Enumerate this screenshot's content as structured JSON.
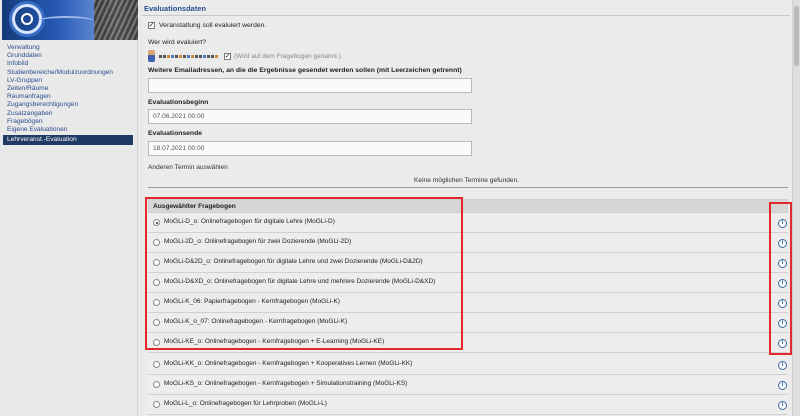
{
  "sidebar": {
    "items": [
      {
        "label": "Verwaltung"
      },
      {
        "label": "Grunddaten"
      },
      {
        "label": "Infobild"
      },
      {
        "label": "Studienbereiche/Modulzuordnungen"
      },
      {
        "label": "LV-Gruppen"
      },
      {
        "label": "Zeiten/Räume"
      },
      {
        "label": "Raumanfragen"
      },
      {
        "label": "Zugangsberechtigungen"
      },
      {
        "label": "Zusatzangaben"
      },
      {
        "label": "Fragebögen"
      },
      {
        "label": "Eigene Evaluationen"
      },
      {
        "label": "Lehrveranst.-Evaluation",
        "active": true
      }
    ]
  },
  "section": {
    "title": "Evaluationsdaten"
  },
  "evaluate_checkbox": {
    "checked": true,
    "label": "Veranstaltung soll evaluiert werden."
  },
  "evaluee": {
    "question": "Wer wird evaluiert?",
    "named_checkbox_checked": true,
    "named_hint": "(Wird auf dem Fragebogen genannt.)"
  },
  "emails": {
    "label": "Weitere Emailadressen, an die die Ergebnisse gesendet werden sollen (mit Leerzeichen getrennt)",
    "value": ""
  },
  "start": {
    "label": "Evaluationsbeginn",
    "value": "07.06.2021 00:00"
  },
  "end": {
    "label": "Evaluationsende",
    "value": "18.07.2021 00:00"
  },
  "other_term": {
    "label": "Anderen Termin auswählen"
  },
  "no_terms": {
    "text": "Keine möglichen Termine gefunden."
  },
  "questionnaire": {
    "header": "Ausgewählter Fragebogen",
    "options": [
      {
        "label": "MoGLi-D_o: Onlinefragebogen für digitale Lehre (MoGLi-D)",
        "selected": true
      },
      {
        "label": "MoGLi-2D_o: Onlinefragebogen für zwei Dozierende (MoGLi-2D)",
        "selected": false
      },
      {
        "label": "MoGLi-D&2D_o: Onlinefragebogen für digitale Lehre und zwei Dozierende (MoGLi-D&2D)",
        "selected": false
      },
      {
        "label": "MoGLi-D&XD_o: Onlinefragebogen für digitale Lehre und mehrere Dozierende (MoGLi-D&XD)",
        "selected": false
      },
      {
        "label": "MoGLi-K_06: Papierfragebogen - Kernfragebogen (MoGLi-K)",
        "selected": false
      },
      {
        "label": "MoGLi-K_o_07: Onlinefragebogen - Kernfragebogen (MoGLi-K)",
        "selected": false
      },
      {
        "label": "MoGLi-KE_o: Onlinefragebogen - Kernfragebogen + E-Learning (MoGLi-KE)",
        "selected": false
      },
      {
        "label": "MoGLi-KK_o: Onlinefragebogen - Kernfragebogen + Kooperatives Lernen (MoGLi-KK)",
        "selected": false
      },
      {
        "label": "MoGLi-KS_o: Onlinefragebogen - Kernfragebogen + Simulationstraining (MoGLi-KS)",
        "selected": false
      },
      {
        "label": "MoGLi-L_o: Onlinefragebogen für Lehrproben (MoGLi-L)",
        "selected": false
      }
    ],
    "info_icon_glyph": "i"
  },
  "colors": {
    "highlight": "#e0282f",
    "active_nav": "#1f3a63",
    "link": "#2a4d8f"
  }
}
